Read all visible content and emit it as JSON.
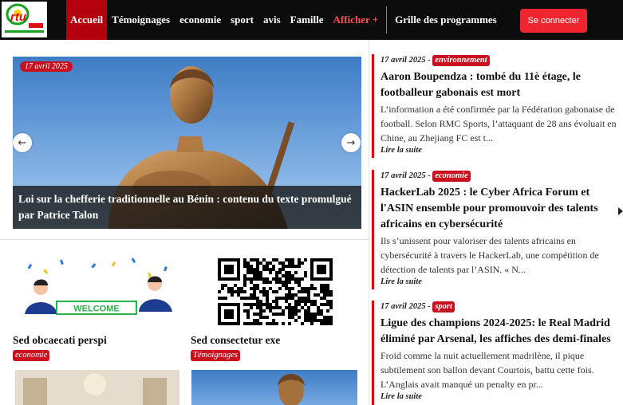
{
  "nav": {
    "logo_text": "rtu",
    "items": [
      {
        "label": "Accueil",
        "active": true
      },
      {
        "label": "Témoignages"
      },
      {
        "label": "economie"
      },
      {
        "label": "sport"
      },
      {
        "label": "avis"
      },
      {
        "label": "Famille"
      },
      {
        "label": "Afficher +",
        "accent": "#ff4f5a"
      },
      {
        "label": "Grille des programmes"
      }
    ],
    "login_label": "Se connecter"
  },
  "hero": {
    "date": "17 avril 2025",
    "caption": "Loi sur la chefferie traditionnelle au Bénin : contenu du texte promulgué par Patrice Talon",
    "prev_icon": "chevron-left-icon",
    "next_icon": "chevron-right-icon"
  },
  "cards": [
    {
      "title": "Sed obcaecati perspi",
      "tag": "economie",
      "image_text": "WELCOME"
    },
    {
      "title": "Sed consectetur exe",
      "tag": "Témoignages"
    }
  ],
  "posts": [
    {
      "date": "17 avril 2025",
      "tag": "environnement",
      "headline": "Aaron Boupendza : tombé du 11è étage, le footballeur gabonais est mort",
      "excerpt": "L’information a été confirmée par la Fédération gabonaise de football. Selon RMC Sports, l’attaquant de 28 ans évoluait en Chine, au Zhejiang FC est t...",
      "more": "Lire la suite"
    },
    {
      "date": "17 avril 2025",
      "tag": "economie",
      "headline": "HackerLab 2025 : le Cyber Africa Forum et l'ASIN ensemble pour promouvoir des talents africains en cybersécurité",
      "excerpt": "Ils s’unissent pour valoriser des talents africains en cybersécurité à travers le HackerLab, une compétition de détection de talents par l’ASIN.   « N...",
      "more": "Lire la suite"
    },
    {
      "date": "17 avril 2025",
      "tag": "sport",
      "headline": "Ligue des champions 2024-2025: le Real Madrid éliminé par Arsenal, les affiches des demi-finales",
      "excerpt": "Froid comme la nuit actuellement madrilène, il pique subtilement son ballon devant Courtois, battu cette fois. L’Anglais avait manqué un penalty en pr...",
      "more": "Lire la suite"
    }
  ],
  "colors": {
    "accent": "#c8101e",
    "nav_bg": "#0c0c0c",
    "login": "#f0252f"
  }
}
